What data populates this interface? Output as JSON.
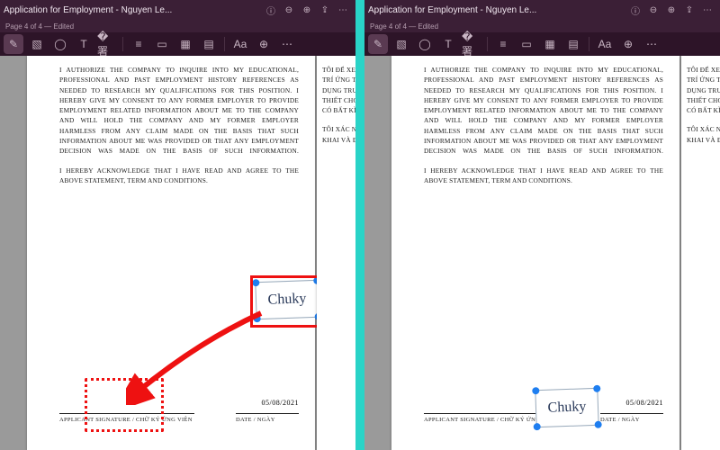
{
  "header": {
    "title": "Application for Employment - Nguyen Le...",
    "subtitle": "Page 4 of 4 — Edited"
  },
  "icons": {
    "info": "ⓘ",
    "zoomOut": "⊖",
    "zoomIn": "⊕",
    "share": "⇪",
    "more": "⋯",
    "pen": "✎",
    "crop": "▧",
    "shape": "◯",
    "text": "T",
    "sign": "�署",
    "list": "≡",
    "note": "▭",
    "grid": "▦",
    "table": "▤",
    "font": "Aa",
    "plus": "⊕",
    "dots": "⋯"
  },
  "doc": {
    "para1": "I AUTHORIZE THE COMPANY TO INQUIRE INTO MY EDUCATIONAL, PROFESSIONAL AND PAST EMPLOYMENT HISTORY REFERENCES AS NEEDED TO RESEARCH MY QUALIFICATIONS FOR THIS POSITION. I HEREBY GIVE MY CONSENT TO ANY FORMER EMPLOYER TO PROVIDE EMPLOYMENT RELATED INFORMATION ABOUT ME TO THE COMPANY AND WILL HOLD THE COMPANY AND MY FORMER EMPLOYER HARMLESS FROM ANY CLAIM MADE ON THE BASIS THAT SUCH INFORMATION ABOUT ME WAS PROVIDED OR THAT ANY EMPLOYMENT DECISION WAS MADE ON THE BASIS OF SUCH INFORMATION.",
    "para2": "I HEREBY ACKNOWLEDGE THAT I HAVE READ AND AGREE TO THE ABOVE STATEMENT, TERM AND CONDITIONS.",
    "sig_label": "APPLICANT SIGNATURE / CHỮ KÝ ỨNG VIÊN",
    "date_label": "DATE / NGÀY",
    "date_value": "05/08/2021",
    "signature_text": "Chuky"
  },
  "side": {
    "b1": "TÔI ĐỂ XEM XÉT KHẢ NĂ\nTRÍ ỨNG TUYỂN. ĐỒNG\nDỤNG TRƯỚC ĐÂY CỦA\nTHIẾT CHO VIỆC TUYỂN\nCÓ BẤT KÌ KHIẾU NẠI N",
    "b2": "TÔI XÁC NHẬN RẰNG T\nKHAI VÀ ĐIỀU KHOẢN N"
  }
}
